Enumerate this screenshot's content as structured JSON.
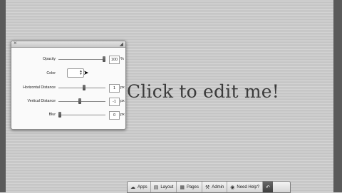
{
  "canvas": {
    "headline": "Click to edit me!"
  },
  "panel": {
    "close_glyph": "×",
    "rows": {
      "opacity": {
        "label": "Opacity",
        "value": "100",
        "unit": "%",
        "level": 1.0
      },
      "color": {
        "label": "Color"
      },
      "horizontal_distance": {
        "label": "Horizontal Distance",
        "value": "1",
        "unit": "px",
        "level": 0.55
      },
      "vertical_distance": {
        "label": "Vertical Distance",
        "value": "-1",
        "unit": "px",
        "level": 0.45
      },
      "blur": {
        "label": "Blur",
        "value": "0",
        "unit": "px",
        "level": 0.0
      }
    }
  },
  "taskbar": {
    "apps": {
      "label": "Apps",
      "icon": "apps-icon"
    },
    "layout": {
      "label": "Layout",
      "icon": "layout-icon"
    },
    "pages": {
      "label": "Pages",
      "icon": "pages-icon"
    },
    "admin": {
      "label": "Admin",
      "icon": "wrench-icon"
    },
    "help": {
      "label": "Need Help?",
      "icon": "help-icon"
    },
    "collapse": {
      "icon": "collapse-icon"
    }
  }
}
